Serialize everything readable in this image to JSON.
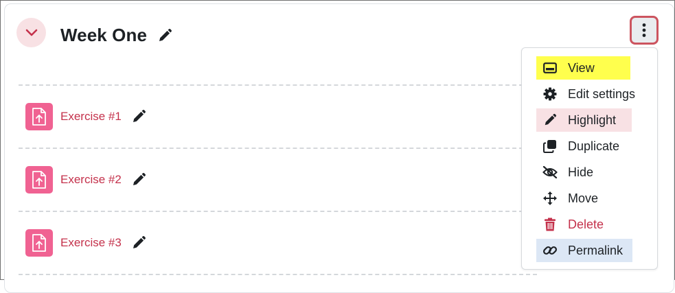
{
  "section": {
    "title": "Week One",
    "collapse_icon": "chevron-down-icon",
    "edit_icon": "pencil-icon"
  },
  "activities": [
    {
      "name": "Exercise #1",
      "icon": "file-upload-icon"
    },
    {
      "name": "Exercise #2",
      "icon": "file-upload-icon"
    },
    {
      "name": "Exercise #3",
      "icon": "file-upload-icon"
    }
  ],
  "actions_menu": {
    "trigger_icon": "kebab-menu-icon",
    "items": [
      {
        "label": "View",
        "icon": "view-card-icon"
      },
      {
        "label": "Edit settings",
        "icon": "gear-icon"
      },
      {
        "label": "Highlight",
        "icon": "pencil-icon"
      },
      {
        "label": "Duplicate",
        "icon": "duplicate-icon"
      },
      {
        "label": "Hide",
        "icon": "eye-slash-icon"
      },
      {
        "label": "Move",
        "icon": "move-arrows-icon"
      },
      {
        "label": "Delete",
        "icon": "trash-icon"
      },
      {
        "label": "Permalink",
        "icon": "link-icon"
      }
    ]
  },
  "colors": {
    "accent_red": "#c4314b",
    "activity_icon_bg": "#f06292",
    "highlight_yellow": "#ffff4d",
    "highlight_pink": "#f8e1e4",
    "highlight_blue": "#dce7f5"
  }
}
